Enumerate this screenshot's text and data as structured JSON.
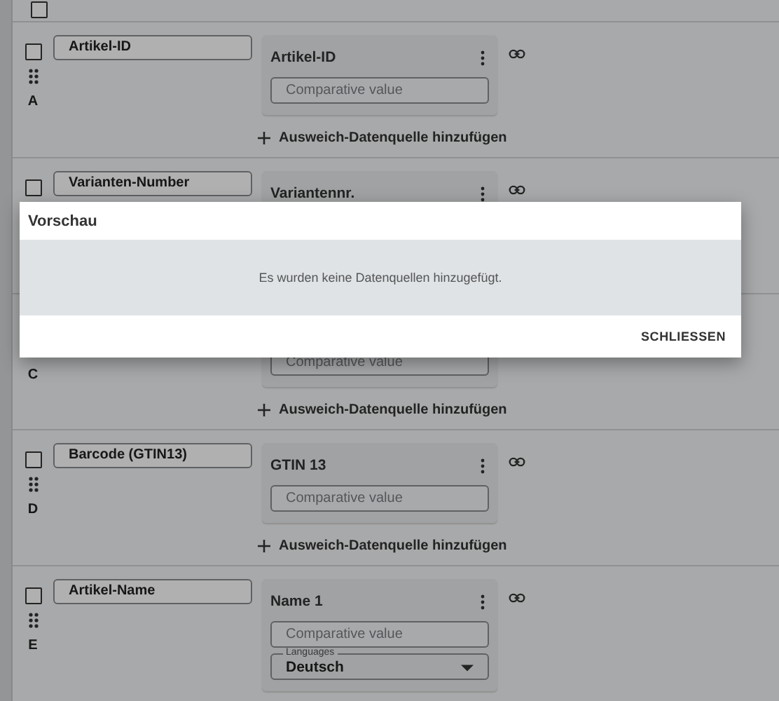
{
  "header_checkbox": {
    "checked": false
  },
  "mappings": [
    {
      "letter": "A",
      "checked": false,
      "field": "Artikel-ID",
      "source": {
        "title": "Artikel-ID",
        "placeholder": "Comparative value"
      },
      "add_link": "Ausweich-Datenquelle hinzufügen"
    },
    {
      "checked": false,
      "field": "Varianten-Number",
      "source": {
        "title": "Variantennr."
      }
    },
    {
      "letter": "C",
      "source": {
        "placeholder": "Comparative value"
      },
      "add_link": "Ausweich-Datenquelle hinzufügen"
    },
    {
      "letter": "D",
      "checked": false,
      "field": "Barcode (GTIN13)",
      "source": {
        "title": "GTIN 13",
        "placeholder": "Comparative value"
      },
      "add_link": "Ausweich-Datenquelle hinzufügen"
    },
    {
      "letter": "E",
      "checked": false,
      "field": "Artikel-Name",
      "source": {
        "title": "Name 1",
        "placeholder": "Comparative value",
        "select": {
          "label": "Languages",
          "value": "Deutsch"
        }
      }
    }
  ],
  "dialog": {
    "title": "Vorschau",
    "message": "Es wurden keine Datenquellen hinzugefügt.",
    "button": "SCHLIESSEN"
  }
}
